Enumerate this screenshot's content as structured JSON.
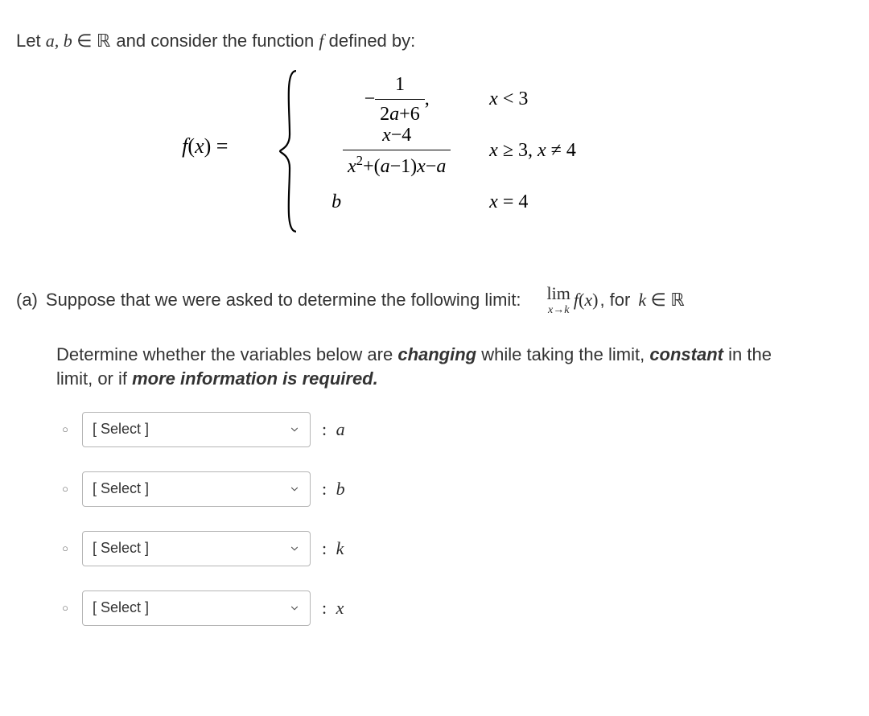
{
  "intro": {
    "pre": "Let ",
    "ab": "a, b",
    "in": " ∈ ",
    "reals": "ℝ",
    "mid": " and consider the function ",
    "f": "f",
    "post": " defined by:"
  },
  "piecewise": {
    "lhs_f": "f",
    "lhs_x": "x",
    "eq": " = ",
    "row1": {
      "num": "1",
      "den_left": "2",
      "den_a": "a",
      "den_right": "+6",
      "comma": " ,",
      "cond_x": "x",
      "cond_rest": " < 3"
    },
    "row2": {
      "num_x": "x",
      "num_rest": "−4",
      "den_x2": "x",
      "den_rest1": "+(",
      "den_a": "a",
      "den_rest2": "−1)",
      "den_x": "x",
      "den_rest3": "−",
      "den_a2": "a",
      "cond_x": "x",
      "cond_ge": " ≥ 3, ",
      "cond_x2": "x",
      "cond_ne": " ≠ 4"
    },
    "row3": {
      "b": "b",
      "cond_x": "x",
      "cond_eq": " = 4"
    }
  },
  "partA": {
    "label": "(a)",
    "lead": "Suppose that we were asked to determine the following limit:",
    "lim": "lim",
    "under_x": "x",
    "under_arrow": "→",
    "under_k": "k",
    "fx_f": "f",
    "fx_x": "x",
    "for": ", for ",
    "k_in_k": "k",
    "k_in_in": " ∈ ",
    "k_in_R": "ℝ"
  },
  "instr": {
    "l1a": "Determine whether the variables below are ",
    "l1b": "changing",
    "l1c": " while taking the limit, ",
    "l1d": "constant",
    "l1e": " in the",
    "l2a": "limit, or if ",
    "l2b": "more information is required.",
    "l2c": ""
  },
  "select_placeholder": "[ Select ]",
  "vars": {
    "a": "a",
    "b": "b",
    "k": "k",
    "x": "x"
  },
  "colon": ":"
}
